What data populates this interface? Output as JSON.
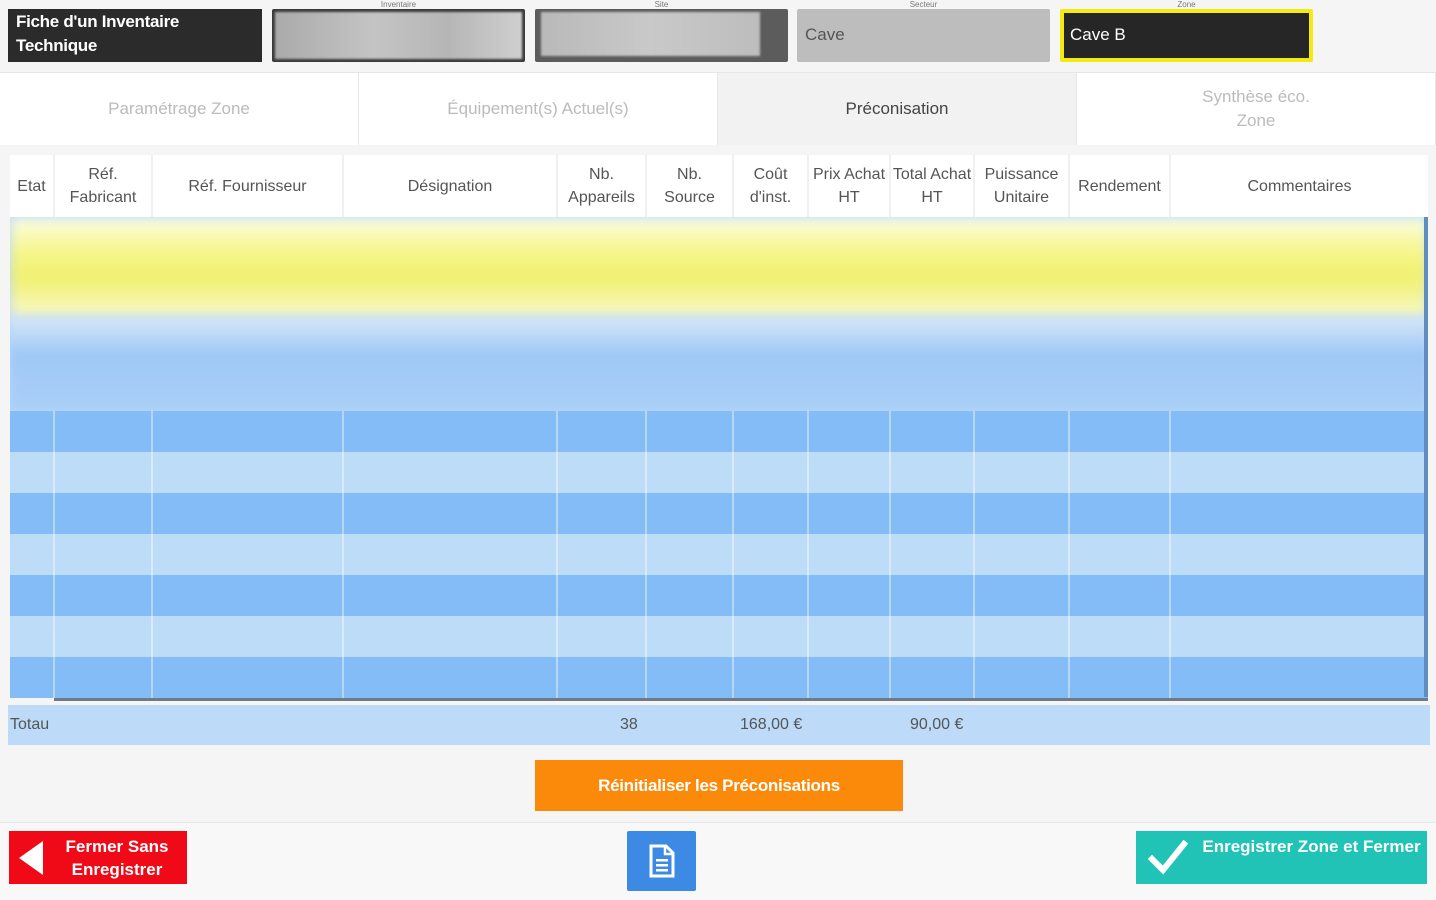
{
  "header": {
    "title": "Fiche d'un Inventaire Technique",
    "inventaire_caption": "Inventaire",
    "site_caption": "Site",
    "secteur_caption": "Secteur",
    "secteur_value": "Cave",
    "zone_caption": "Zone",
    "zone_value": "Cave B"
  },
  "tabs": [
    {
      "label": "Paramétrage Zone"
    },
    {
      "label": "Équipement(s) Actuel(s)"
    },
    {
      "label": "Préconisation"
    },
    {
      "label": "Synthèse éco. Zone"
    }
  ],
  "table": {
    "columns": [
      "Etat",
      "Réf. Fabricant",
      "Réf. Fournisseur",
      "Désignation",
      "Nb. Appareils",
      "Nb. Source",
      "Coût d'inst.",
      "Prix Achat HT",
      "Total Achat HT",
      "Puissance Unitaire",
      "Rendement",
      "Commentaires"
    ]
  },
  "totals": {
    "label": "Totau",
    "nb_appareils": "38",
    "cout_inst": "168,00 €",
    "total_achat": "90,00 €"
  },
  "actions": {
    "reset_label": "Réinitialiser les Préconisations",
    "close_label": "Fermer Sans Enregistrer",
    "save_label": "Enregistrer Zone et Fermer"
  },
  "colors": {
    "accent_orange": "#fb8a0b",
    "close_red": "#f00a17",
    "save_teal": "#21c3b7",
    "doc_blue": "#3d8ae4",
    "zone_highlight": "#f2ea10"
  }
}
